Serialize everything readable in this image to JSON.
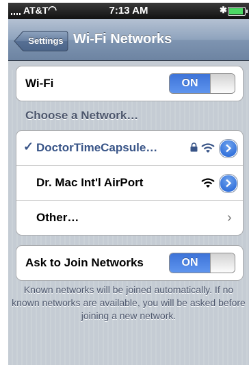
{
  "status_bar": {
    "carrier": "AT&T",
    "time": "7:13 AM"
  },
  "nav": {
    "back_label": "Settings",
    "title": "Wi-Fi Networks"
  },
  "wifi_toggle": {
    "label": "Wi-Fi",
    "state": "ON"
  },
  "networks": {
    "section_header": "Choose a Network…",
    "items": [
      {
        "name": "DoctorTimeCapsule…",
        "selected": true,
        "secured": true
      },
      {
        "name": "Dr. Mac Int'l AirPort",
        "selected": false,
        "secured": false
      }
    ],
    "other_label": "Other…"
  },
  "ask_to_join": {
    "label": "Ask to Join Networks",
    "state": "ON",
    "footer": "Known networks will be joined automatically. If no known networks are available, you will be asked before joining a new network."
  },
  "colors": {
    "accent_blue": "#3d73d8",
    "navbar": "#7e94b1",
    "background": "#c5ccd4",
    "checkmark": "#385487"
  }
}
